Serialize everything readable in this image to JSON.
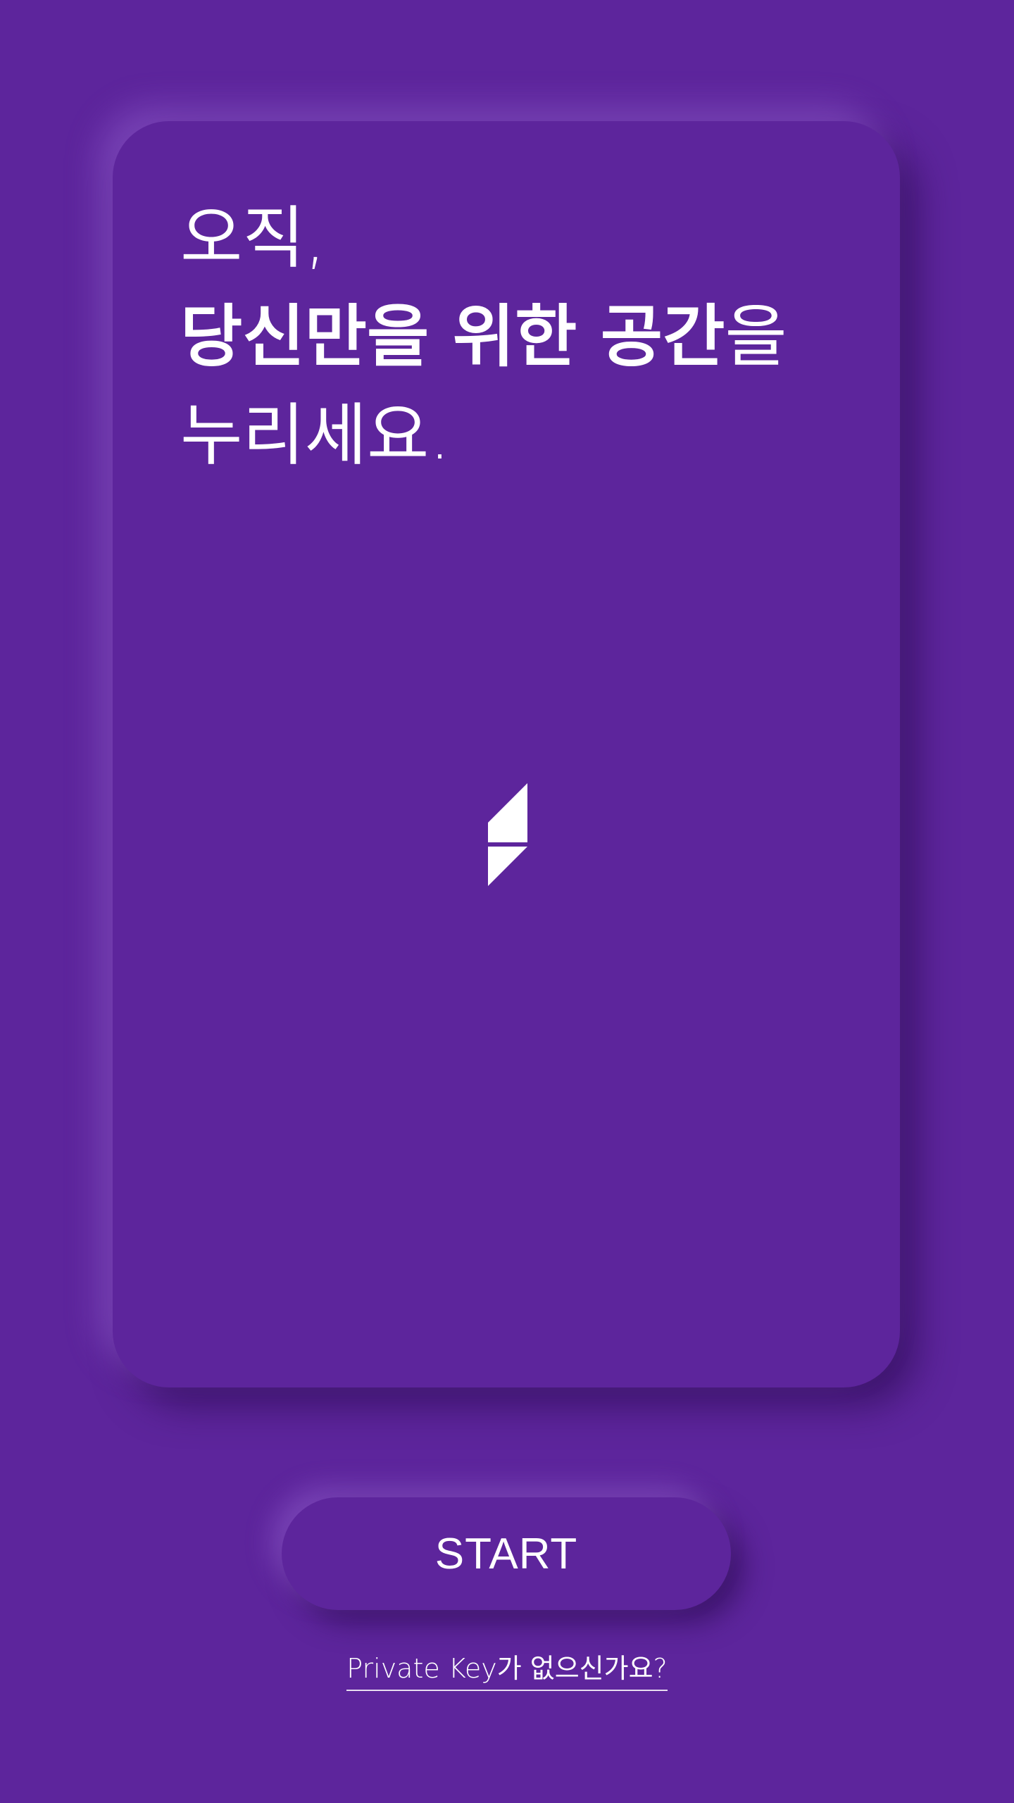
{
  "headline": {
    "line1": "오직,",
    "line2_bold": "당신만을 위한 공간",
    "line2_light": "을",
    "line3": "누리세요."
  },
  "logo": {
    "icon": "brand-logo-icon",
    "color": "#ffffff"
  },
  "start_button": {
    "label": "START"
  },
  "no_private_key_link": {
    "label": "Private Key가 없으신가요?"
  },
  "colors": {
    "background": "#5d259c",
    "text": "#ffffff"
  }
}
